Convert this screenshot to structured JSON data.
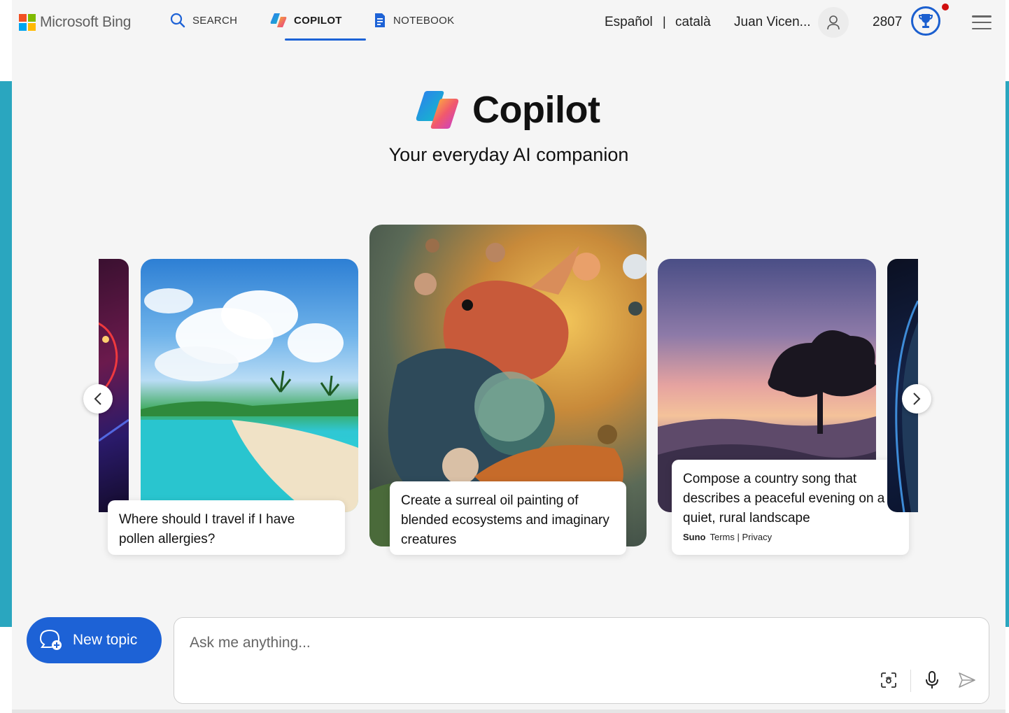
{
  "brand": {
    "logo_text": "Microsoft Bing"
  },
  "nav": {
    "search": "SEARCH",
    "copilot": "COPILOT",
    "notebook": "NOTEBOOK"
  },
  "header": {
    "lang_1": "Español",
    "separator": "|",
    "lang_2": "català",
    "user_name": "Juan Vicen...",
    "points": "2807"
  },
  "hero": {
    "title": "Copilot",
    "subtitle": "Your everyday AI companion"
  },
  "carousel": {
    "cards": [
      {
        "prompt": "Where should I travel if I have pollen allergies?"
      },
      {
        "prompt": "Create a surreal oil painting of blended ecosystems and imaginary creatures"
      },
      {
        "prompt": "Compose a country song that describes a peaceful evening on a quiet, rural landscape",
        "provider": "Suno",
        "links": "Terms | Privacy"
      }
    ]
  },
  "chat": {
    "new_topic": "New topic",
    "placeholder": "Ask me anything..."
  },
  "colors": {
    "accent": "#1d62d6",
    "edge": "#2aa6bf"
  }
}
